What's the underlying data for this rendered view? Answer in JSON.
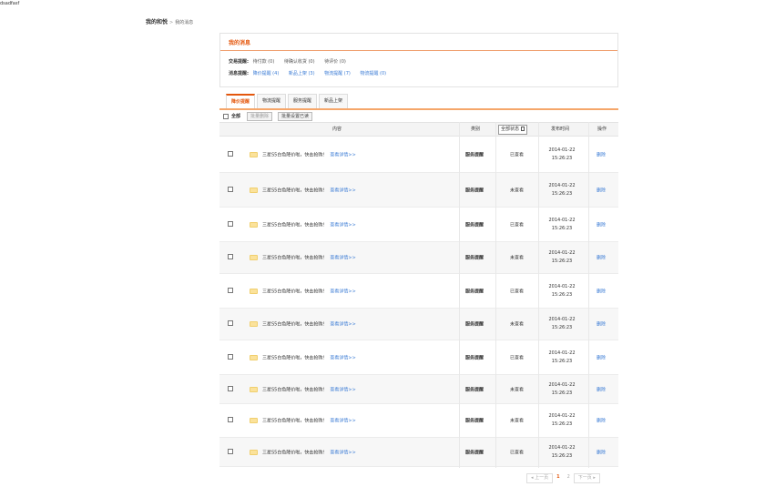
{
  "debug_text": "dsadfasf",
  "breadcrumb": {
    "root": "我的和悦",
    "separator": ">",
    "current": "我的消息"
  },
  "msgbox": {
    "title": "我的消息",
    "trade_label": "交易提醒:",
    "trade_items": [
      "待付款 (0)",
      "待确认收货 (0)",
      "待评价 (0)"
    ],
    "msg_label": "消息提醒:",
    "msg_items": [
      "降价提醒 (4)",
      "新品上架 (3)",
      "物流提醒 (7)",
      "物流提醒 (0)"
    ]
  },
  "tabs": [
    {
      "label": "降价提醒",
      "active": true
    },
    {
      "label": "物流提醒",
      "active": false
    },
    {
      "label": "服务提醒",
      "active": false
    },
    {
      "label": "新品上架",
      "active": false
    }
  ],
  "toolbar": {
    "select_all": "全部",
    "batch_delete": "批量删除",
    "batch_read": "批量设置已读"
  },
  "table": {
    "headers": {
      "content": "内容",
      "type": "类别",
      "status": "全部状态",
      "time": "发布时间",
      "op": "操作"
    },
    "rows": [
      {
        "title": "三星S5白色降价啦，快去抢购!",
        "more": "查看详情>>",
        "type": "服务提醒",
        "status": "已查看",
        "date": "2014-01-22",
        "clock": "15:26:23",
        "op": "删除"
      },
      {
        "title": "三星S5白色降价啦，快去抢购!",
        "more": "查看详情>>",
        "type": "服务提醒",
        "status": "未查看",
        "date": "2014-01-22",
        "clock": "15:26:23",
        "op": "删除"
      },
      {
        "title": "三星S5白色降价啦，快去抢购!",
        "more": "查看详情>>",
        "type": "服务提醒",
        "status": "已查看",
        "date": "2014-01-22",
        "clock": "15:26:23",
        "op": "删除"
      },
      {
        "title": "三星S5白色降价啦，快去抢购!",
        "more": "查看详情>>",
        "type": "服务提醒",
        "status": "未查看",
        "date": "2014-01-22",
        "clock": "15:26:23",
        "op": "删除"
      },
      {
        "title": "三星S5白色降价啦，快去抢购!",
        "more": "查看详情>>",
        "type": "服务提醒",
        "status": "已查看",
        "date": "2014-01-22",
        "clock": "15:26:23",
        "op": "删除"
      },
      {
        "title": "三星S5白色降价啦，快去抢购!",
        "more": "查看详情>>",
        "type": "服务提醒",
        "status": "未查看",
        "date": "2014-01-22",
        "clock": "15:26:23",
        "op": "删除"
      },
      {
        "title": "三星S5白色降价啦，快去抢购!",
        "more": "查看详情>>",
        "type": "服务提醒",
        "status": "已查看",
        "date": "2014-01-22",
        "clock": "15:26:23",
        "op": "删除"
      },
      {
        "title": "三星S5白色降价啦，快去抢购!",
        "more": "查看详情>>",
        "type": "服务提醒",
        "status": "未查看",
        "date": "2014-01-22",
        "clock": "15:26:23",
        "op": "删除"
      },
      {
        "title": "三星S5白色降价啦，快去抢购!",
        "more": "查看详情>>",
        "type": "服务提醒",
        "status": "未查看",
        "date": "2014-01-22",
        "clock": "15:26:23",
        "op": "删除"
      },
      {
        "title": "三星S5白色降价啦，快去抢购!",
        "more": "查看详情>>",
        "type": "服务提醒",
        "status": "已查看",
        "date": "2014-01-22",
        "clock": "15:26:23",
        "op": "删除"
      }
    ]
  },
  "pager": {
    "prev": "◂ 上一页",
    "pages": [
      "1",
      "2"
    ],
    "current": "1",
    "next": "下一页 ▸"
  },
  "colors": {
    "accent": "#e4570d",
    "link": "#3a7bd5"
  }
}
